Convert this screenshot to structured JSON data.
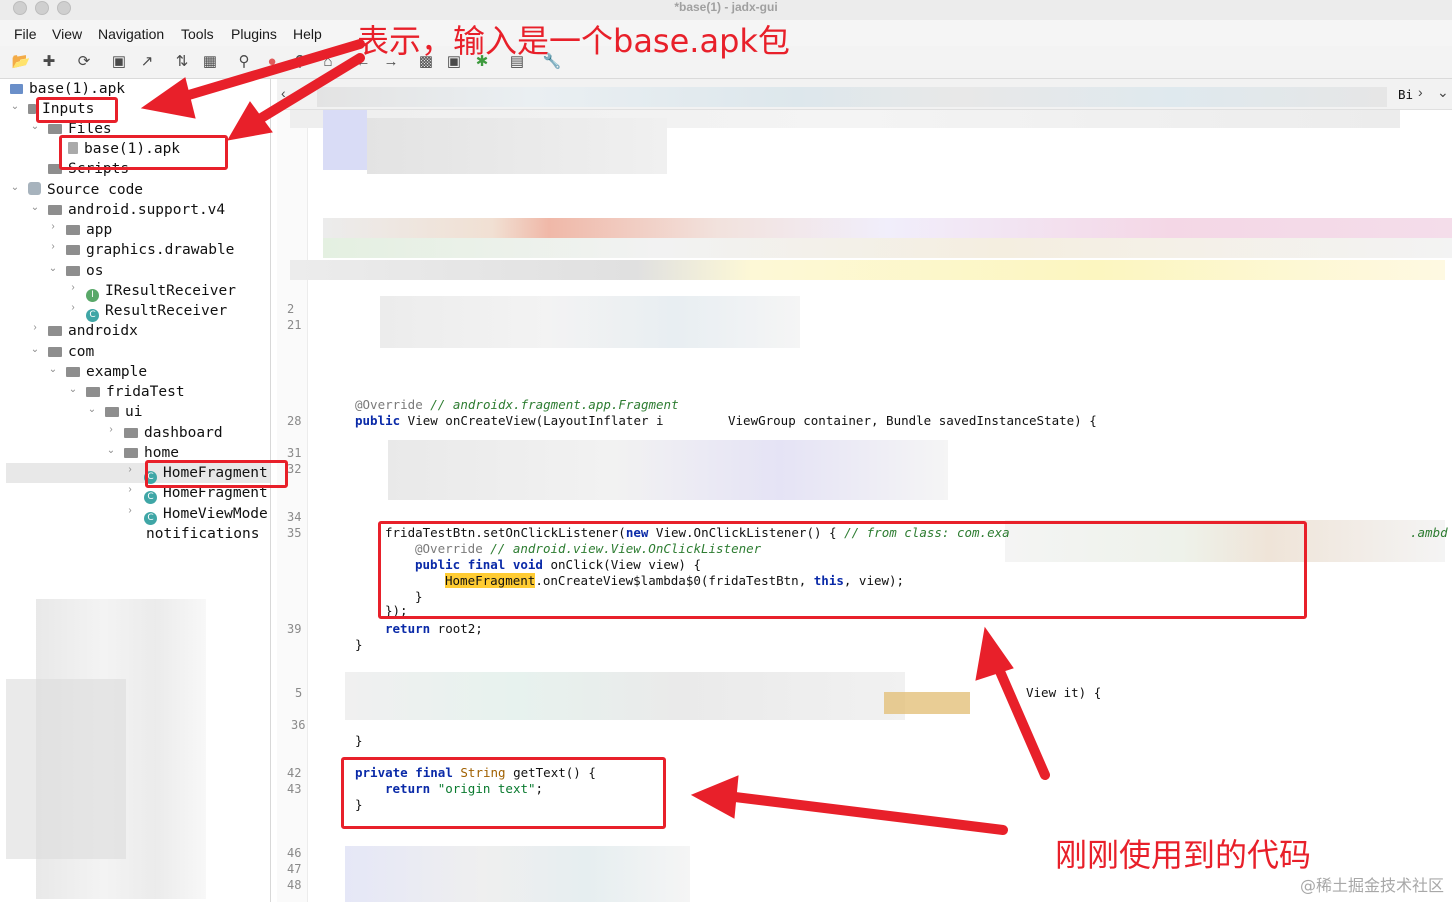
{
  "window": {
    "title": "*base(1) - jadx-gui"
  },
  "menu": [
    "File",
    "View",
    "Navigation",
    "Tools",
    "Plugins",
    "Help"
  ],
  "toolbar_icons": [
    "open-icon",
    "add-icon",
    "reload-icon",
    "save-icon",
    "export-icon",
    "sync-icon",
    "flatten-icon",
    "search-icon",
    "stop-icon",
    "find-icon",
    "home-icon",
    "back-icon",
    "forward-icon",
    "decompile-icon",
    "deobf-icon",
    "debug-icon",
    "log-icon",
    "settings-icon"
  ],
  "tree": {
    "root": "base(1).apk",
    "inputs": "Inputs",
    "files": "Files",
    "apk": "base(1).apk",
    "scripts": "Scripts",
    "source_code": "Source code",
    "android_support_v4": "android.support.v4",
    "app": "app",
    "graphics_drawable": "graphics.drawable",
    "os": "os",
    "iresult": "IResultReceiver",
    "result": "ResultReceiver",
    "androidx": "androidx",
    "com": "com",
    "example": "example",
    "fridatest": "fridaTest",
    "ui": "ui",
    "dashboard": "dashboard",
    "home": "home",
    "homefragment1": "HomeFragment",
    "homefragment2": "HomeFragment",
    "homeviewmode": "HomeViewMode",
    "notifications": "notifications"
  },
  "editor": {
    "tab_right": "Bi",
    "line_numbers": [
      "2",
      "21",
      "28",
      "31",
      "32",
      "34",
      "35",
      "39",
      "5",
      "36",
      "42",
      "43",
      "46",
      "47",
      "48"
    ],
    "code": {
      "override1": "@Override",
      "cm1": "// androidx.fragment.app.Fragment",
      "kw_public": "public",
      "oncreate_rest": " View onCreateView(LayoutInflater i",
      "oncreate_tail": "ViewGroup container, Bundle savedInstanceState) {",
      "listener_a": "fridaTestBtn.setOnClickListener(",
      "kw_new": "new",
      "listener_b": " View.OnClickListener() { ",
      "cm2": "// from class: com.exa",
      "lambda_tail": ".ambd",
      "override2": "@Override",
      "cm3": "// android.view.View.OnClickListener",
      "kw_public2": "public",
      "kw_final": "final",
      "kw_void": "void",
      "onclick": " onClick(View view) {",
      "hl_home": "HomeFragment",
      "lambda_call": ".onCreateView$lambda$0(fridaTestBtn, ",
      "kw_this": "this",
      "lambda_end": ", view);",
      "close_brace": "}",
      "close_paren": "});",
      "kw_return": "return",
      "return_val": " root2;",
      "brace_a": "}",
      "view_it": "View it) {",
      "brace_b": "}",
      "kw_private": "private",
      "kw_final2": "final",
      "ty_string": "String",
      "gettext": " getText() {",
      "kw_return2": "return",
      "str_origin": "\"origin text\"",
      "semi": ";",
      "brace_c": "}"
    }
  },
  "annotations": {
    "top": "表示，输入是一个base.apk包",
    "bottom": "刚刚使用到的代码",
    "accent": "#e8202a"
  },
  "watermark": "@稀土掘金技术社区"
}
